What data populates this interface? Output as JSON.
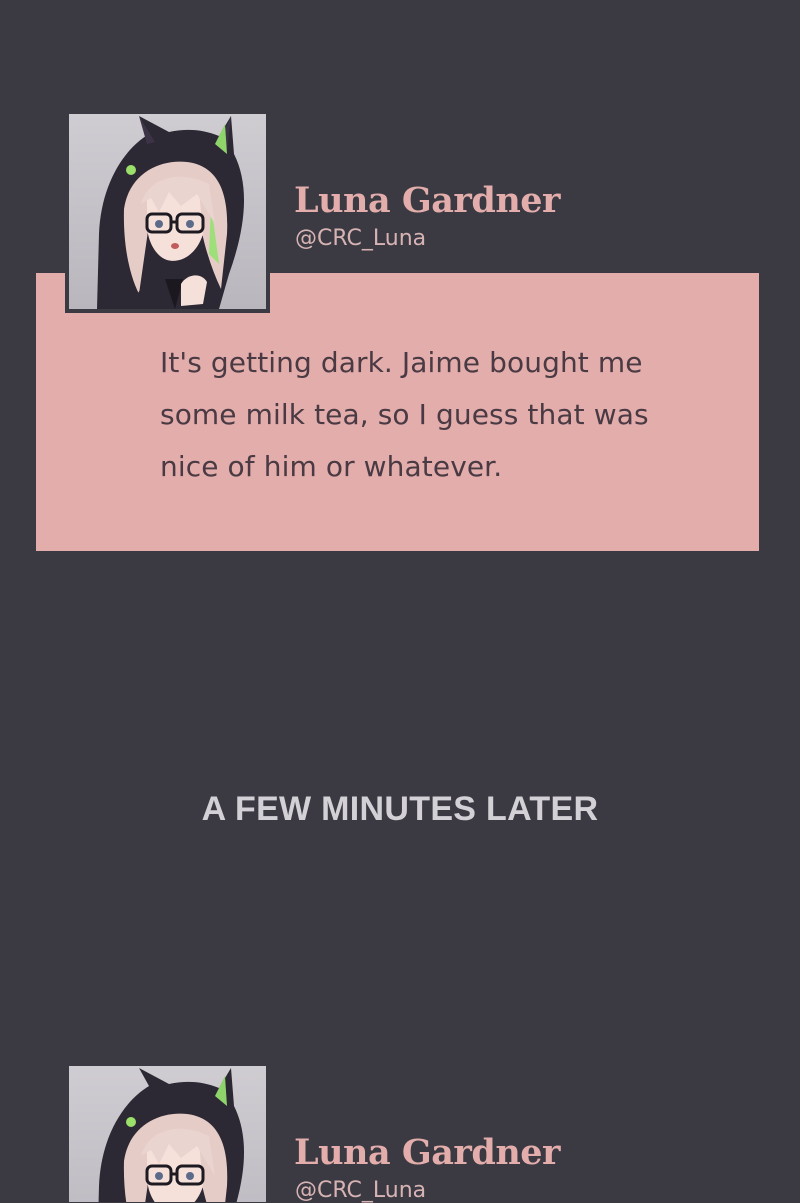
{
  "posts": [
    {
      "author": "Luna Gardner",
      "handle": "@CRC_Luna",
      "text": "It's getting dark. Jaime bought me some milk tea, so I guess that was nice of him or whatever."
    },
    {
      "author": "Luna Gardner",
      "handle": "@CRC_Luna"
    }
  ],
  "caption": "A FEW MINUTES LATER",
  "colors": {
    "background": "#3b3a43",
    "bubble": "#e3adab",
    "name": "#e3adab",
    "bubble_text": "#4a3a44",
    "caption": "#d3d1d6"
  },
  "icons": {
    "avatar": "avatar-cat-hood-girl"
  }
}
